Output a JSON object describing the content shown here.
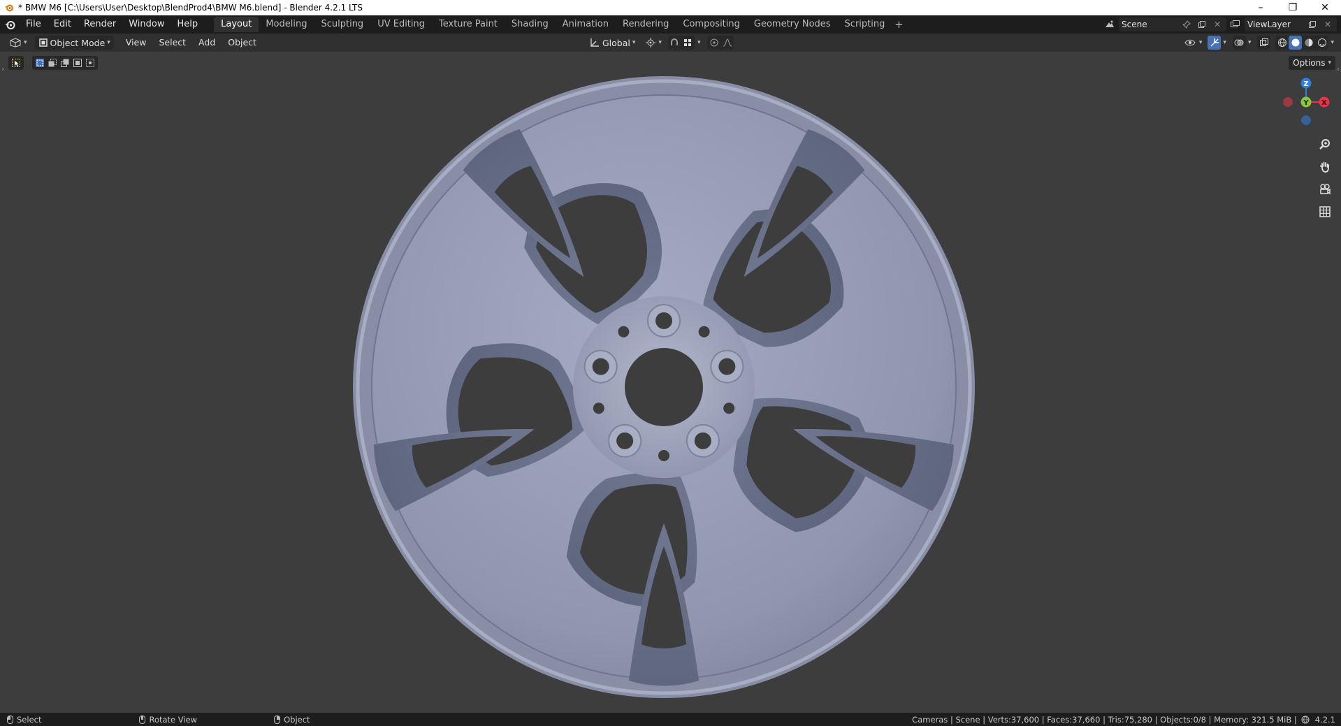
{
  "window": {
    "title": "* BMW M6 [C:\\Users\\User\\Desktop\\BlendProd4\\BMW M6.blend] - Blender 4.2.1 LTS",
    "minimize": "–",
    "restore": "❐",
    "close": "✕"
  },
  "menu": [
    "File",
    "Edit",
    "Render",
    "Window",
    "Help"
  ],
  "workspaces": {
    "tabs": [
      "Layout",
      "Modeling",
      "Sculpting",
      "UV Editing",
      "Texture Paint",
      "Shading",
      "Animation",
      "Rendering",
      "Compositing",
      "Geometry Nodes",
      "Scripting"
    ],
    "active": "Layout",
    "add": "+"
  },
  "scene": {
    "name": "Scene"
  },
  "view_layer": {
    "name": "ViewLayer"
  },
  "viewport_header": {
    "mode": "Object Mode",
    "menus": [
      "View",
      "Select",
      "Add",
      "Object"
    ],
    "orientation": "Global"
  },
  "viewport": {
    "options_label": "Options",
    "gizmo_axes": {
      "z": "Z",
      "y": "Y",
      "x": "X"
    },
    "colors": {
      "background": "#3d3d3d",
      "wheel": "#8f96ae",
      "x_axis": "#e8344a",
      "y_axis": "#8cc63f",
      "z_axis": "#2f7fdc"
    }
  },
  "statusbar": {
    "hints": [
      {
        "label": "Select",
        "icon": "mouse-left-icon"
      },
      {
        "label": "Rotate View",
        "icon": "mouse-middle-icon"
      },
      {
        "label": "Object",
        "icon": "mouse-right-icon"
      }
    ],
    "stats": "Cameras | Scene | Verts:37,600 | Faces:37,660 | Tris:75,280 | Objects:0/8 | Memory: 321.5 MiB |",
    "version": "4.2.1"
  }
}
